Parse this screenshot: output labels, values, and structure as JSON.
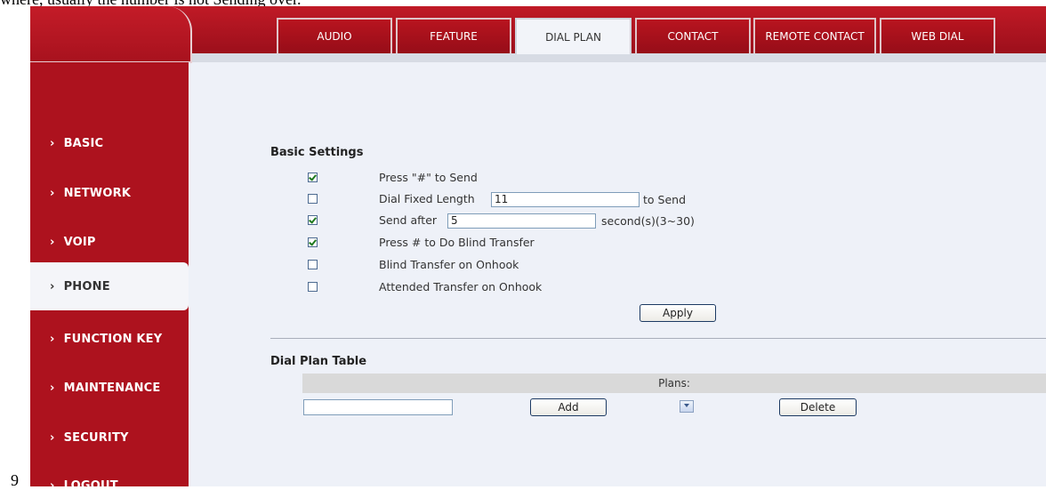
{
  "doc": {
    "top_fragment": "where, usually the number is not Sending over.",
    "page_number": "9"
  },
  "tabs": [
    {
      "label": "AUDIO"
    },
    {
      "label": "FEATURE"
    },
    {
      "label": "DIAL PLAN"
    },
    {
      "label": "CONTACT"
    },
    {
      "label": "REMOTE CONTACT"
    },
    {
      "label": "WEB DIAL"
    }
  ],
  "sidebar": {
    "chevron": "›",
    "items": [
      {
        "label": "BASIC"
      },
      {
        "label": "NETWORK"
      },
      {
        "label": "VOIP"
      },
      {
        "label": "PHONE"
      },
      {
        "label": "FUNCTION KEY"
      },
      {
        "label": "MAINTENANCE"
      },
      {
        "label": "SECURITY"
      },
      {
        "label": "LOGOUT"
      }
    ],
    "active": "PHONE"
  },
  "basic_settings": {
    "title": "Basic Settings",
    "press_hash": {
      "label": "Press \"#\" to Send",
      "checked": true
    },
    "fixed_length": {
      "label": "Dial Fixed Length",
      "value": "11",
      "suffix": "to Send",
      "checked": false
    },
    "send_after": {
      "label": "Send after",
      "value": "5",
      "suffix": "second(s)(3~30)",
      "checked": true
    },
    "blind_transfer": {
      "label": "Press # to Do Blind Transfer",
      "checked": true
    },
    "blind_onhook": {
      "label": "Blind Transfer on Onhook",
      "checked": false
    },
    "attended_onhook": {
      "label": "Attended Transfer on Onhook",
      "checked": false
    },
    "apply_label": "Apply"
  },
  "dial_plan_table": {
    "title": "Dial Plan Table",
    "header": "Plans:",
    "input_value": "",
    "add_label": "Add",
    "delete_label": "Delete"
  },
  "colors": {
    "brand_red": "#ad121e",
    "content_bg": "#eef1f8",
    "check_green": "#1f7a1f"
  }
}
